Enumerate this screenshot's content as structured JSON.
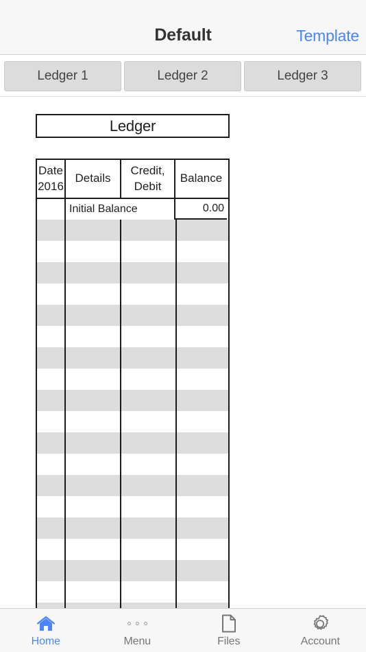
{
  "nav": {
    "title": "Default",
    "action_label": "Template"
  },
  "segments": [
    {
      "label": "Ledger 1"
    },
    {
      "label": "Ledger 2"
    },
    {
      "label": "Ledger 3"
    }
  ],
  "sheet": {
    "title": "Ledger",
    "table": {
      "headers": {
        "date_line1": "Date",
        "date_line2": "2016",
        "details": "Details",
        "credit_line1": "Credit,",
        "credit_line2": "Debit",
        "balance": "Balance"
      },
      "initial_row": {
        "date": "",
        "details": "Initial Balance",
        "balance": "0.00"
      },
      "empty_row_count": 18
    }
  },
  "tabs": [
    {
      "label": "Home",
      "icon": "home-icon",
      "active": true
    },
    {
      "label": "Menu",
      "icon": "ellipsis-icon",
      "active": false
    },
    {
      "label": "Files",
      "icon": "document-icon",
      "active": false
    },
    {
      "label": "Account",
      "icon": "gear-icon",
      "active": false
    }
  ],
  "colors": {
    "accent": "#4a86f7",
    "chrome_background": "#f7f7f7",
    "stripe_gray": "#dddddd",
    "table_border": "#1a1a1a",
    "segment_fill": "#dcdcdc"
  }
}
